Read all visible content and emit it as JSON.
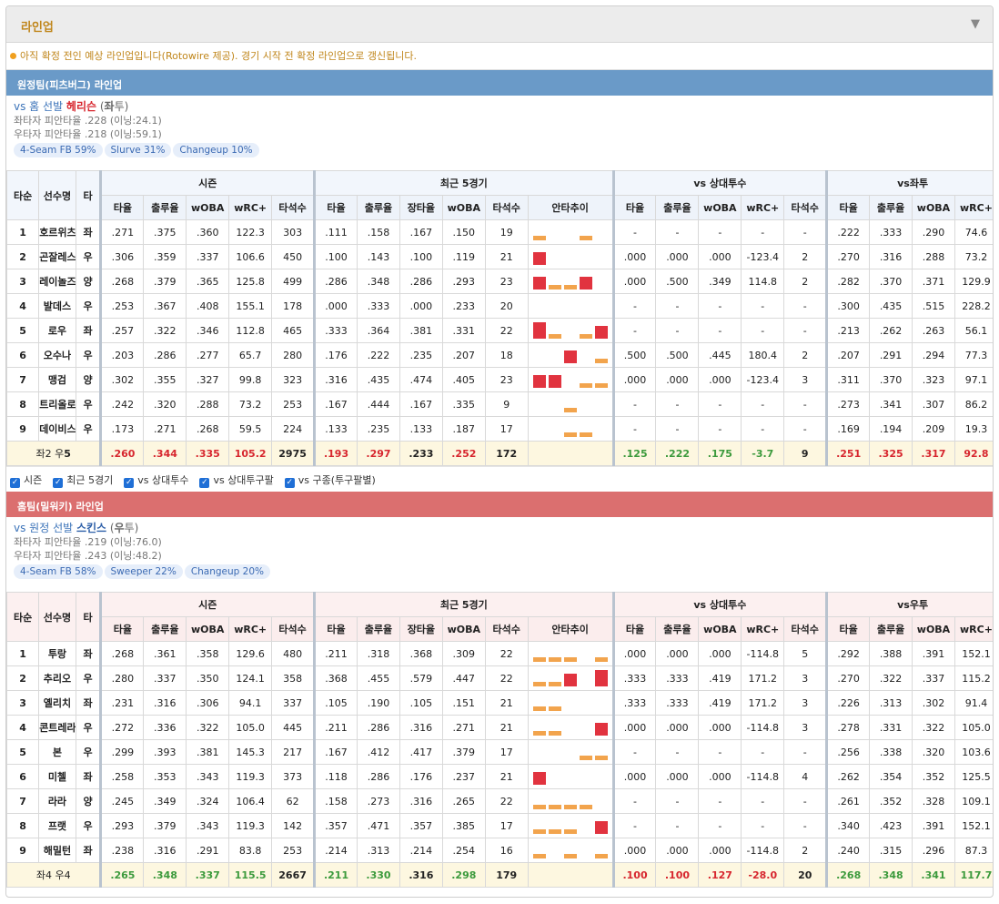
{
  "header": {
    "title": "라인업",
    "toggle": "▼"
  },
  "notice": "아직 확정 전인 예상 라인업입니다(Rotowire 제공). 경기 시작 전 확정 라인업으로 갱신됩니다.",
  "colors": {
    "away_bar": "#6a9ac8",
    "home_bar": "#db6f6f",
    "accent": "#c0861b",
    "up": "#3c9a3c",
    "down": "#d7262e"
  },
  "checks": [
    "시즌",
    "최근 5경기",
    "vs 상대투수",
    "vs 상대투구팔",
    "vs 구종(투구팔별)"
  ],
  "teams": [
    {
      "bar": "원정팀(피츠버그) 라인업",
      "vs_prefix": "vs 홈 선발 ",
      "pitcher": "헤리슨",
      "hand": "좌투",
      "lhb": "좌타자 피안타율 .228 (이닝:24.1)",
      "rhb": "우타자 피안타율 .218 (이닝:59.1)",
      "pitches": [
        "4-Seam FB 59%",
        "Slurve 31%",
        "Changeup 10%"
      ],
      "groups": {
        "order": "타순",
        "name": "선수명",
        "bat": "타",
        "season": "시즌",
        "recent": "최근 5경기",
        "vsp": "vs 상대투수",
        "vsh": "vs좌투"
      },
      "cols": {
        "season": [
          "타율",
          "출루율",
          "wOBA",
          "wRC+",
          "타석수"
        ],
        "recent": [
          "타율",
          "출루율",
          "장타율",
          "wOBA",
          "타석수",
          "안타추이"
        ],
        "vsp": [
          "타율",
          "출루율",
          "wOBA",
          "wRC+",
          "타석수"
        ],
        "vsh": [
          "타율",
          "출루율",
          "wOBA",
          "wRC+"
        ]
      },
      "rows": [
        {
          "o": "1",
          "n": "호르위츠",
          "b": "좌",
          "s": [
            ".271",
            ".375",
            ".360",
            "122.3",
            "303"
          ],
          "r": [
            ".111",
            ".158",
            ".167",
            ".150",
            "19"
          ],
          "tr": [
            0.3,
            0,
            0,
            0.3,
            0
          ],
          "p": [
            "-",
            "-",
            "-",
            "-",
            "-"
          ],
          "h": [
            ".222",
            ".333",
            ".290",
            "74.6"
          ]
        },
        {
          "o": "2",
          "n": "곤잘레스",
          "b": "우",
          "s": [
            ".306",
            ".359",
            ".337",
            "106.6",
            "450"
          ],
          "r": [
            ".100",
            ".143",
            ".100",
            ".119",
            "21"
          ],
          "tr": [
            0.75,
            0,
            0,
            0,
            0
          ],
          "p": [
            ".000",
            ".000",
            ".000",
            "-123.4",
            "2"
          ],
          "h": [
            ".270",
            ".316",
            ".288",
            "73.2"
          ]
        },
        {
          "o": "3",
          "n": "레이놀즈",
          "b": "양",
          "s": [
            ".268",
            ".379",
            ".365",
            "125.8",
            "499"
          ],
          "r": [
            ".286",
            ".348",
            ".286",
            ".293",
            "23"
          ],
          "tr": [
            0.75,
            0.3,
            0.3,
            0.75,
            0
          ],
          "p": [
            ".000",
            ".500",
            ".349",
            "114.8",
            "2"
          ],
          "h": [
            ".282",
            ".370",
            ".371",
            "129.9"
          ]
        },
        {
          "o": "4",
          "n": "발데스",
          "b": "우",
          "s": [
            ".253",
            ".367",
            ".408",
            "155.1",
            "178"
          ],
          "r": [
            ".000",
            ".333",
            ".000",
            ".233",
            "20"
          ],
          "tr": [
            0,
            0,
            0,
            0,
            0
          ],
          "p": [
            "-",
            "-",
            "-",
            "-",
            "-"
          ],
          "h": [
            ".300",
            ".435",
            ".515",
            "228.2"
          ]
        },
        {
          "o": "5",
          "n": "로우",
          "b": "좌",
          "s": [
            ".257",
            ".322",
            ".346",
            "112.8",
            "465"
          ],
          "r": [
            ".333",
            ".364",
            ".381",
            ".331",
            "22"
          ],
          "tr": [
            1,
            0.3,
            0,
            0.3,
            0.75
          ],
          "p": [
            "-",
            "-",
            "-",
            "-",
            "-"
          ],
          "h": [
            ".213",
            ".262",
            ".263",
            "56.1"
          ]
        },
        {
          "o": "6",
          "n": "오수나",
          "b": "우",
          "s": [
            ".203",
            ".286",
            ".277",
            "65.7",
            "280"
          ],
          "r": [
            ".176",
            ".222",
            ".235",
            ".207",
            "18"
          ],
          "tr": [
            0,
            0,
            0.75,
            0,
            0.3
          ],
          "p": [
            ".500",
            ".500",
            ".445",
            "180.4",
            "2"
          ],
          "h": [
            ".207",
            ".291",
            ".294",
            "77.3"
          ]
        },
        {
          "o": "7",
          "n": "맹검",
          "b": "양",
          "s": [
            ".302",
            ".355",
            ".327",
            "99.8",
            "323"
          ],
          "r": [
            ".316",
            ".435",
            ".474",
            ".405",
            "23"
          ],
          "tr": [
            0.75,
            0.75,
            0,
            0.3,
            0.3
          ],
          "p": [
            ".000",
            ".000",
            ".000",
            "-123.4",
            "3"
          ],
          "h": [
            ".311",
            ".370",
            ".323",
            "97.1"
          ]
        },
        {
          "o": "8",
          "n": "트리올로",
          "b": "우",
          "s": [
            ".242",
            ".320",
            ".288",
            "73.2",
            "253"
          ],
          "r": [
            ".167",
            ".444",
            ".167",
            ".335",
            "9"
          ],
          "tr": [
            0,
            0,
            0.3,
            0,
            0
          ],
          "p": [
            "-",
            "-",
            "-",
            "-",
            "-"
          ],
          "h": [
            ".273",
            ".341",
            ".307",
            "86.2"
          ]
        },
        {
          "o": "9",
          "n": "데이비스",
          "b": "우",
          "s": [
            ".173",
            ".271",
            ".268",
            "59.5",
            "224"
          ],
          "r": [
            ".133",
            ".235",
            ".133",
            ".187",
            "17"
          ],
          "tr": [
            0,
            0,
            0.3,
            0.3,
            0
          ],
          "p": [
            "-",
            "-",
            "-",
            "-",
            "-"
          ],
          "h": [
            ".169",
            ".194",
            ".209",
            "19.3"
          ]
        }
      ],
      "sum": {
        "label_pre": "좌2 우",
        "label_bold": "5",
        "s": [
          ".260",
          ".344",
          ".335",
          "105.2",
          "2975"
        ],
        "s_c": [
          "red",
          "red",
          "red",
          "red",
          "blk"
        ],
        "r": [
          ".193",
          ".297",
          ".233",
          ".252",
          "172"
        ],
        "r_c": [
          "red",
          "red",
          "blk",
          "red",
          "blk"
        ],
        "p": [
          ".125",
          ".222",
          ".175",
          "-3.7",
          "9"
        ],
        "p_c": [
          "green",
          "green",
          "green",
          "green",
          "blk"
        ],
        "h": [
          ".251",
          ".325",
          ".317",
          "92.8"
        ],
        "h_c": [
          "red",
          "red",
          "red",
          "red"
        ]
      }
    },
    {
      "bar": "홈팀(밀워키) 라인업",
      "vs_prefix": "vs 원정 선발 ",
      "pitcher": "스킨스",
      "hand": "우투",
      "lhb": "좌타자 피안타율 .219 (이닝:76.0)",
      "rhb": "우타자 피안타율 .243 (이닝:48.2)",
      "pitches": [
        "4-Seam FB 58%",
        "Sweeper 22%",
        "Changeup 20%"
      ],
      "groups": {
        "order": "타순",
        "name": "선수명",
        "bat": "타",
        "season": "시즌",
        "recent": "최근 5경기",
        "vsp": "vs 상대투수",
        "vsh": "vs우투"
      },
      "cols": {
        "season": [
          "타율",
          "출루율",
          "wOBA",
          "wRC+",
          "타석수"
        ],
        "recent": [
          "타율",
          "출루율",
          "장타율",
          "wOBA",
          "타석수",
          "안타추이"
        ],
        "vsp": [
          "타율",
          "출루율",
          "wOBA",
          "wRC+",
          "타석수"
        ],
        "vsh": [
          "타율",
          "출루율",
          "wOBA",
          "wRC+"
        ]
      },
      "rows": [
        {
          "o": "1",
          "n": "투랑",
          "b": "좌",
          "s": [
            ".268",
            ".361",
            ".358",
            "129.6",
            "480"
          ],
          "r": [
            ".211",
            ".318",
            ".368",
            ".309",
            "22"
          ],
          "tr": [
            0.3,
            0.3,
            0.3,
            0,
            0.3
          ],
          "p": [
            ".000",
            ".000",
            ".000",
            "-114.8",
            "5"
          ],
          "h": [
            ".292",
            ".388",
            ".391",
            "152.1"
          ]
        },
        {
          "o": "2",
          "n": "추리오",
          "b": "우",
          "s": [
            ".280",
            ".337",
            ".350",
            "124.1",
            "358"
          ],
          "r": [
            ".368",
            ".455",
            ".579",
            ".447",
            "22"
          ],
          "tr": [
            0.3,
            0.3,
            0.75,
            0,
            1
          ],
          "p": [
            ".333",
            ".333",
            ".419",
            "171.2",
            "3"
          ],
          "h": [
            ".270",
            ".322",
            ".337",
            "115.2"
          ]
        },
        {
          "o": "3",
          "n": "옐리치",
          "b": "좌",
          "s": [
            ".231",
            ".316",
            ".306",
            "94.1",
            "337"
          ],
          "r": [
            ".105",
            ".190",
            ".105",
            ".151",
            "21"
          ],
          "tr": [
            0.3,
            0.3,
            0,
            0,
            0
          ],
          "p": [
            ".333",
            ".333",
            ".419",
            "171.2",
            "3"
          ],
          "h": [
            ".226",
            ".313",
            ".302",
            "91.4"
          ]
        },
        {
          "o": "4",
          "n": "콘트레라스",
          "b": "우",
          "s": [
            ".272",
            ".336",
            ".322",
            "105.0",
            "445"
          ],
          "r": [
            ".211",
            ".286",
            ".316",
            ".271",
            "21"
          ],
          "tr": [
            0.3,
            0.3,
            0,
            0,
            0.75
          ],
          "p": [
            ".000",
            ".000",
            ".000",
            "-114.8",
            "3"
          ],
          "h": [
            ".278",
            ".331",
            ".322",
            "105.0"
          ]
        },
        {
          "o": "5",
          "n": "본",
          "b": "우",
          "s": [
            ".299",
            ".393",
            ".381",
            "145.3",
            "217"
          ],
          "r": [
            ".167",
            ".412",
            ".417",
            ".379",
            "17"
          ],
          "tr": [
            0,
            0,
            0,
            0.3,
            0.3
          ],
          "p": [
            "-",
            "-",
            "-",
            "-",
            "-"
          ],
          "h": [
            ".256",
            ".338",
            ".320",
            "103.6"
          ]
        },
        {
          "o": "6",
          "n": "미첼",
          "b": "좌",
          "s": [
            ".258",
            ".353",
            ".343",
            "119.3",
            "373"
          ],
          "r": [
            ".118",
            ".286",
            ".176",
            ".237",
            "21"
          ],
          "tr": [
            0.75,
            0,
            0,
            0,
            0
          ],
          "p": [
            ".000",
            ".000",
            ".000",
            "-114.8",
            "4"
          ],
          "h": [
            ".262",
            ".354",
            ".352",
            "125.5"
          ]
        },
        {
          "o": "7",
          "n": "라라",
          "b": "양",
          "s": [
            ".245",
            ".349",
            ".324",
            "106.4",
            "62"
          ],
          "r": [
            ".158",
            ".273",
            ".316",
            ".265",
            "22"
          ],
          "tr": [
            0.3,
            0.3,
            0.3,
            0.3,
            0
          ],
          "p": [
            "-",
            "-",
            "-",
            "-",
            "-"
          ],
          "h": [
            ".261",
            ".352",
            ".328",
            "109.1"
          ]
        },
        {
          "o": "8",
          "n": "프랫",
          "b": "우",
          "s": [
            ".293",
            ".379",
            ".343",
            "119.3",
            "142"
          ],
          "r": [
            ".357",
            ".471",
            ".357",
            ".385",
            "17"
          ],
          "tr": [
            0.3,
            0.3,
            0.3,
            0,
            0.75
          ],
          "p": [
            "-",
            "-",
            "-",
            "-",
            "-"
          ],
          "h": [
            ".340",
            ".423",
            ".391",
            "152.1"
          ]
        },
        {
          "o": "9",
          "n": "해밀턴",
          "b": "좌",
          "s": [
            ".238",
            ".316",
            ".291",
            "83.8",
            "253"
          ],
          "r": [
            ".214",
            ".313",
            ".214",
            ".254",
            "16"
          ],
          "tr": [
            0.3,
            0,
            0.3,
            0,
            0.3
          ],
          "p": [
            ".000",
            ".000",
            ".000",
            "-114.8",
            "2"
          ],
          "h": [
            ".240",
            ".315",
            ".296",
            "87.3"
          ]
        }
      ],
      "sum": {
        "label_pre": "좌4 우4",
        "label_bold": "",
        "s": [
          ".265",
          ".348",
          ".337",
          "115.5",
          "2667"
        ],
        "s_c": [
          "green",
          "green",
          "green",
          "green",
          "blk"
        ],
        "r": [
          ".211",
          ".330",
          ".316",
          ".298",
          "179"
        ],
        "r_c": [
          "green",
          "green",
          "blk",
          "green",
          "blk"
        ],
        "p": [
          ".100",
          ".100",
          ".127",
          "-28.0",
          "20"
        ],
        "p_c": [
          "red",
          "red",
          "red",
          "red",
          "blk"
        ],
        "h": [
          ".268",
          ".348",
          ".341",
          "117.7"
        ],
        "h_c": [
          "green",
          "green",
          "green",
          "green"
        ]
      }
    }
  ]
}
